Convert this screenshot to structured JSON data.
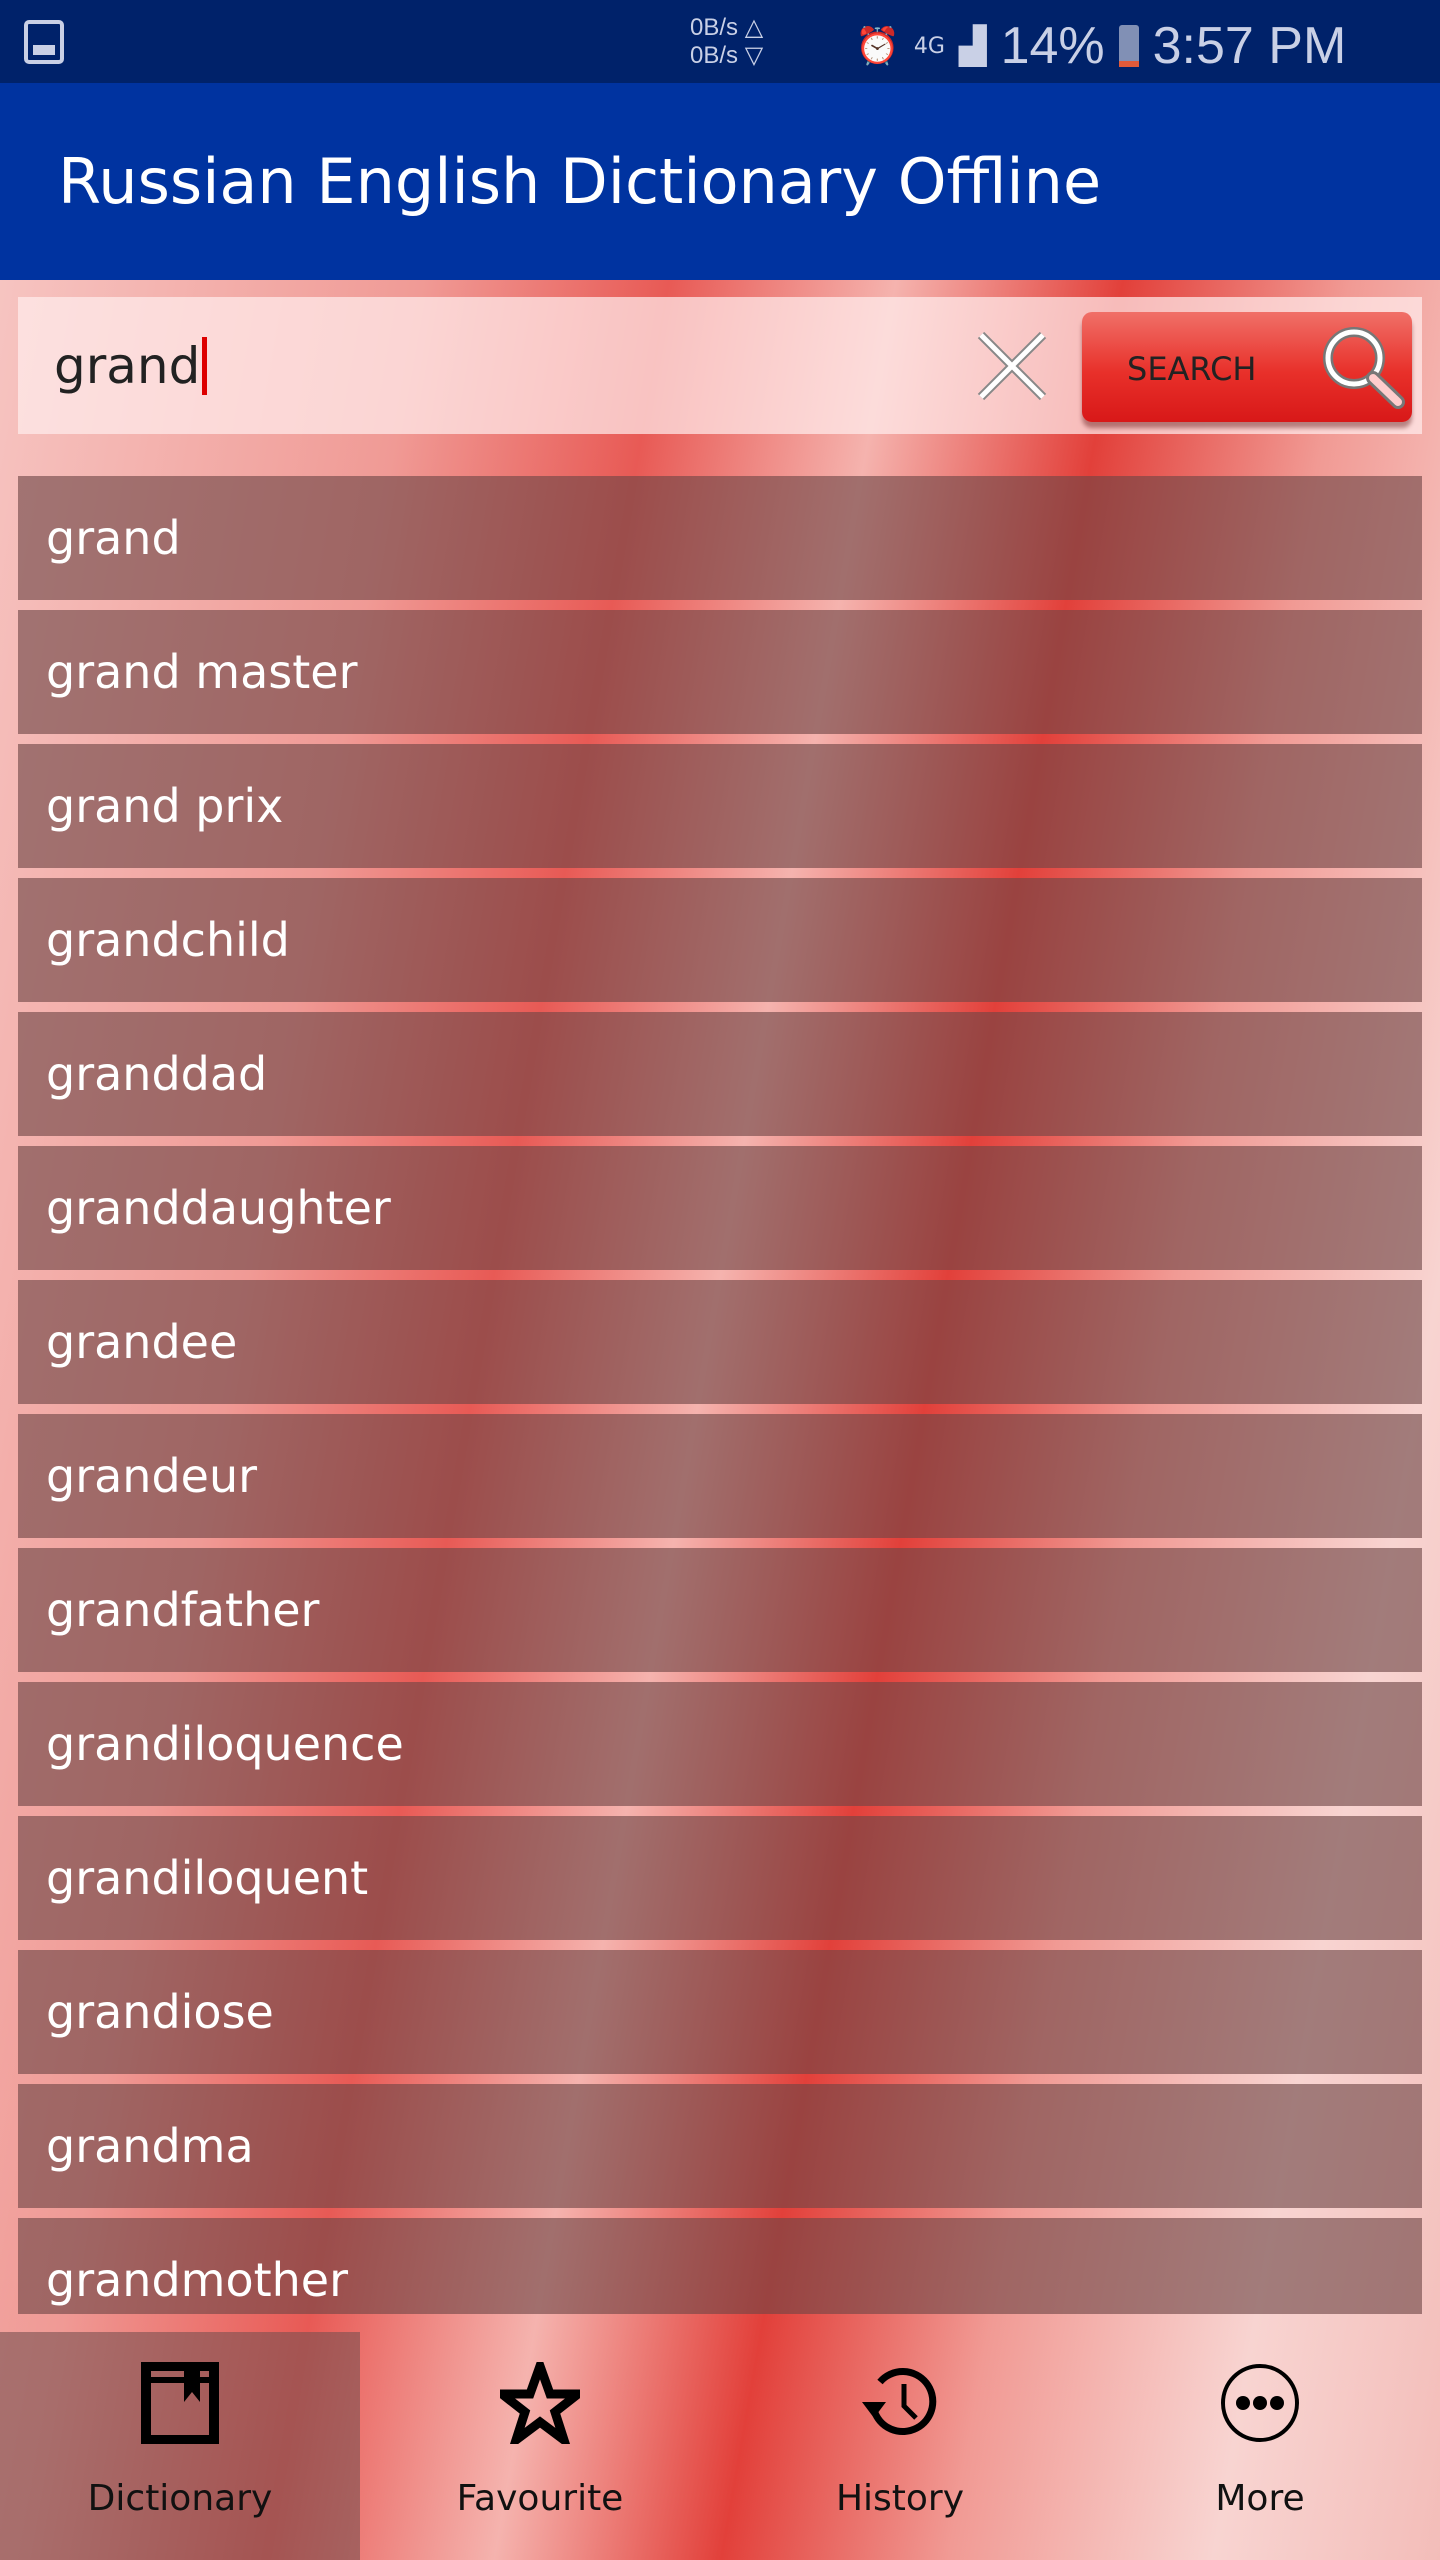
{
  "status_bar": {
    "net_up": "0B/s △",
    "net_down": "0B/s ▽",
    "network": "4G",
    "battery": "14%",
    "time": "3:57 PM",
    "battery_level": 14
  },
  "app_bar": {
    "title": "Russian English Dictionary Offline"
  },
  "search": {
    "value": "grand",
    "button_label": "SEARCH"
  },
  "results": [
    "grand",
    "grand master",
    "grand prix",
    "grandchild",
    "granddad",
    "granddaughter",
    "grandee",
    "grandeur",
    "grandfather",
    "grandiloquence",
    "grandiloquent",
    "grandiose",
    "grandma",
    "grandmother"
  ],
  "bottom_nav": [
    {
      "label": "Dictionary",
      "icon": "book-bookmark-icon",
      "selected": true
    },
    {
      "label": "Favourite",
      "icon": "star-icon"
    },
    {
      "label": "History",
      "icon": "history-icon"
    },
    {
      "label": "More",
      "icon": "more-icon"
    }
  ],
  "colors": {
    "status_bar": "#00226a",
    "app_bar": "#0033a0",
    "search_button": "#e8302a",
    "cursor": "#dd0000"
  }
}
